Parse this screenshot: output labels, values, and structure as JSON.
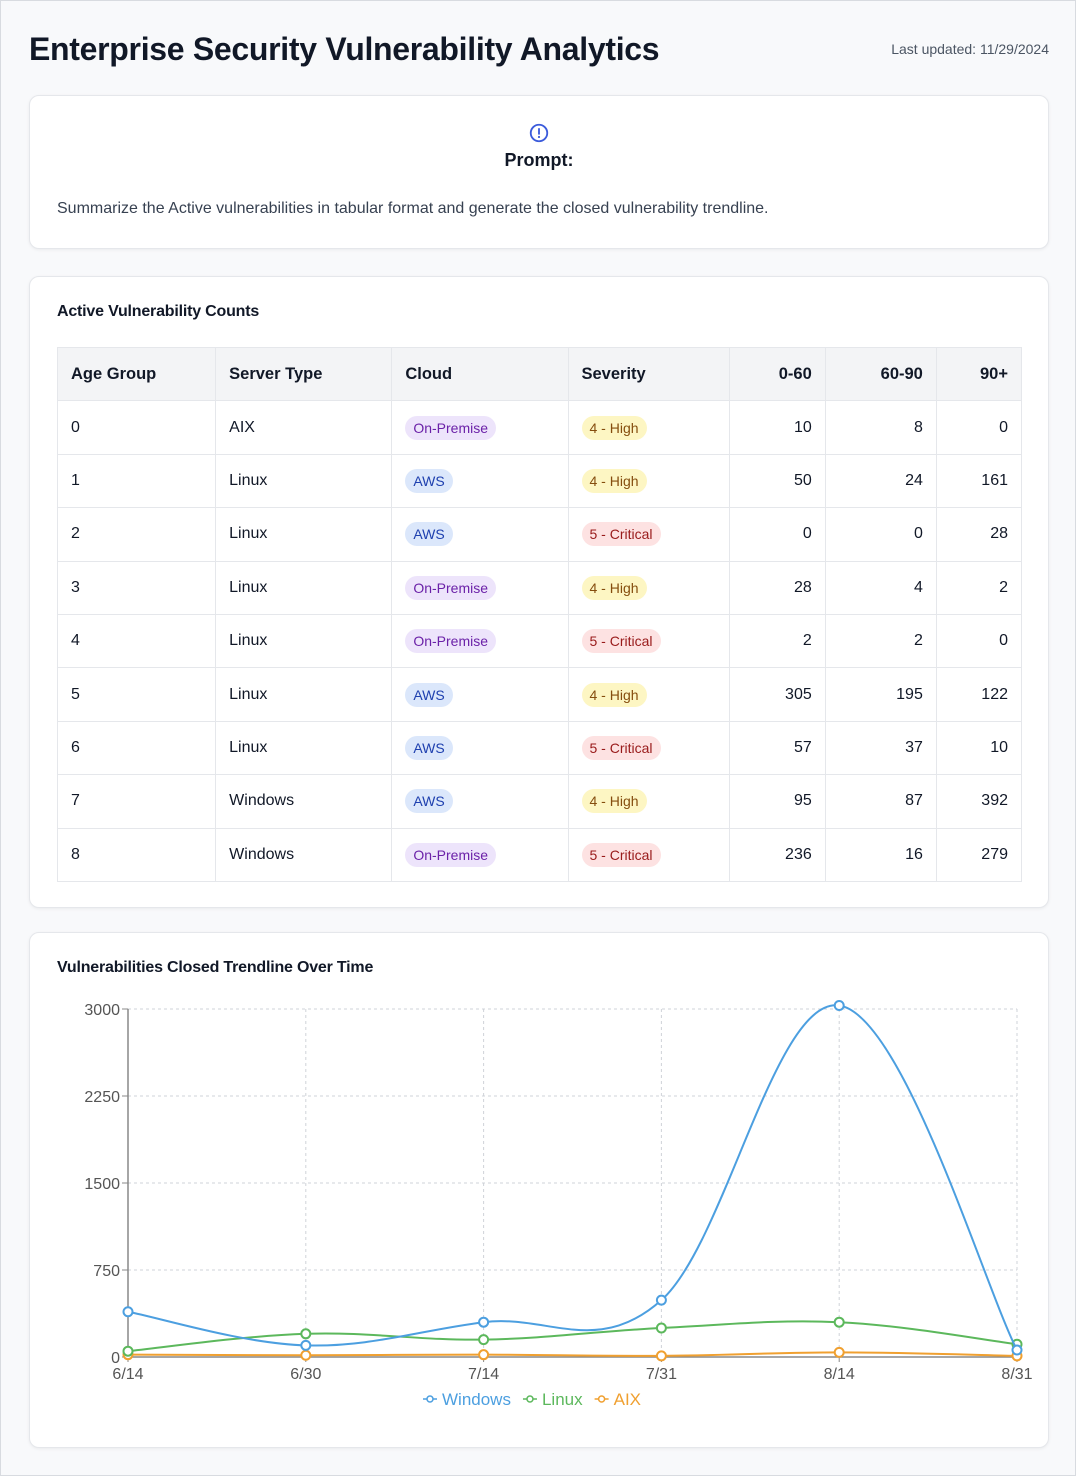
{
  "header": {
    "title": "Enterprise Security Vulnerability Analytics",
    "last_updated": "Last updated: 11/29/2024"
  },
  "prompt": {
    "icon": "alert-circle-icon",
    "label": "Prompt:",
    "text": "Summarize the Active vulnerabilities in tabular format and generate the closed vulnerability trendline."
  },
  "active_table": {
    "title": "Active Vulnerability Counts",
    "columns": [
      "Age Group",
      "Server Type",
      "Cloud",
      "Severity",
      "0-60",
      "60-90",
      "90+"
    ],
    "rows": [
      {
        "age_group": "0",
        "server_type": "AIX",
        "cloud": "On-Premise",
        "severity": "4 - High",
        "d0_60": "10",
        "d60_90": "8",
        "d90_plus": "0"
      },
      {
        "age_group": "1",
        "server_type": "Linux",
        "cloud": "AWS",
        "severity": "4 - High",
        "d0_60": "50",
        "d60_90": "24",
        "d90_plus": "161"
      },
      {
        "age_group": "2",
        "server_type": "Linux",
        "cloud": "AWS",
        "severity": "5 - Critical",
        "d0_60": "0",
        "d60_90": "0",
        "d90_plus": "28"
      },
      {
        "age_group": "3",
        "server_type": "Linux",
        "cloud": "On-Premise",
        "severity": "4 - High",
        "d0_60": "28",
        "d60_90": "4",
        "d90_plus": "2"
      },
      {
        "age_group": "4",
        "server_type": "Linux",
        "cloud": "On-Premise",
        "severity": "5 - Critical",
        "d0_60": "2",
        "d60_90": "2",
        "d90_plus": "0"
      },
      {
        "age_group": "5",
        "server_type": "Linux",
        "cloud": "AWS",
        "severity": "4 - High",
        "d0_60": "305",
        "d60_90": "195",
        "d90_plus": "122"
      },
      {
        "age_group": "6",
        "server_type": "Linux",
        "cloud": "AWS",
        "severity": "5 - Critical",
        "d0_60": "57",
        "d60_90": "37",
        "d90_plus": "10"
      },
      {
        "age_group": "7",
        "server_type": "Windows",
        "cloud": "AWS",
        "severity": "4 - High",
        "d0_60": "95",
        "d60_90": "87",
        "d90_plus": "392"
      },
      {
        "age_group": "8",
        "server_type": "Windows",
        "cloud": "On-Premise",
        "severity": "5 - Critical",
        "d0_60": "236",
        "d60_90": "16",
        "d90_plus": "279"
      }
    ],
    "badge_colors": {
      "AWS": {
        "bg": "#dbe7fb",
        "fg": "#1e40af"
      },
      "On-Premise": {
        "bg": "#ede4fb",
        "fg": "#6b21a8"
      },
      "4 - High": {
        "bg": "#fdf6c3",
        "fg": "#854d0e"
      },
      "5 - Critical": {
        "bg": "#fde2e2",
        "fg": "#991b1b"
      }
    }
  },
  "chart_section": {
    "title": "Vulnerabilities Closed Trendline Over Time"
  },
  "chart_data": {
    "type": "line",
    "title": "",
    "xlabel": "",
    "ylabel": "",
    "x": [
      "6/14",
      "6/30",
      "7/14",
      "7/31",
      "8/14",
      "8/31"
    ],
    "ylim": [
      0,
      3000
    ],
    "yticks": [
      "0",
      "750",
      "1500",
      "2250",
      "3000"
    ],
    "grid": true,
    "legend_position": "bottom",
    "series": [
      {
        "name": "Windows",
        "color": "#4c9fe0",
        "values": [
          390,
          100,
          300,
          490,
          3030,
          60
        ]
      },
      {
        "name": "Linux",
        "color": "#5cb85c",
        "values": [
          50,
          200,
          150,
          250,
          300,
          110
        ]
      },
      {
        "name": "AIX",
        "color": "#f0a030",
        "values": [
          20,
          15,
          20,
          10,
          40,
          10
        ]
      }
    ]
  }
}
